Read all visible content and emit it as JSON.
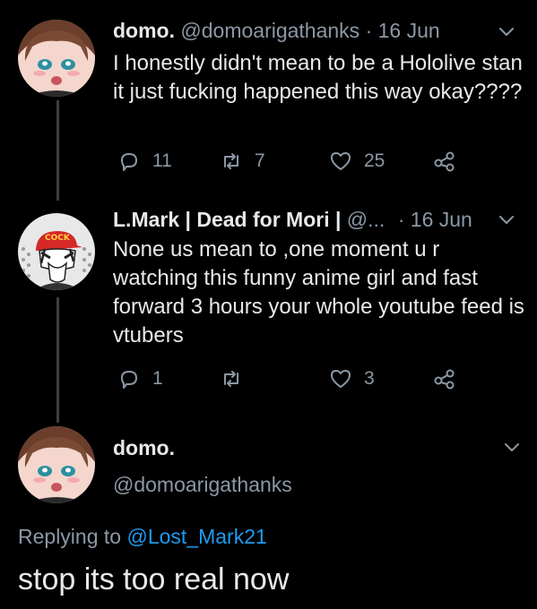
{
  "colors": {
    "background": "#000000",
    "primary_text": "#e7e9ea",
    "secondary_text": "#8b98a5",
    "link": "#1d9bf0",
    "thread_line": "#3a3f44"
  },
  "tweets": [
    {
      "avatar_icon": "anime-girl-avatar",
      "display_name": "domo.",
      "handle": "@domoarigathanks",
      "separator": "·",
      "date": "16 Jun",
      "text": "I honestly didn't mean to be a Hololive stan it just fucking happened this way okay????",
      "replies": "11",
      "retweets": "7",
      "likes": "25"
    },
    {
      "avatar_icon": "red-cap-character-avatar",
      "avatar_cap_text": "COCK",
      "display_name": "L.Mark | Dead for Mori |",
      "handle": "@...",
      "separator": "·",
      "date": "16 Jun",
      "text": "None us mean to ,one moment u r watching this funny anime girl and fast forward 3 hours your whole youtube feed is vtubers",
      "replies": "1",
      "retweets": "",
      "likes": "3"
    }
  ],
  "main_tweet": {
    "avatar_icon": "anime-girl-avatar",
    "display_name": "domo.",
    "handle": "@domoarigathanks",
    "replying_prefix": "Replying to",
    "replying_to": "@Lost_Mark21",
    "text": "stop its too real now"
  }
}
